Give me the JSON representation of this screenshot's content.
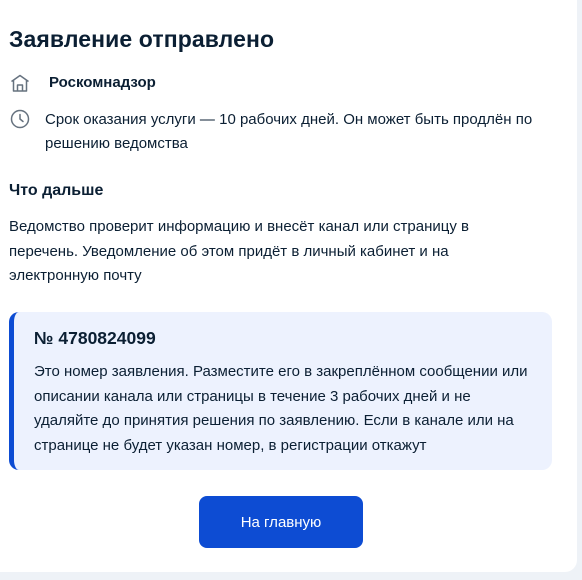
{
  "title": "Заявление отправлено",
  "organization": {
    "icon": "building-icon",
    "name": "Роскомнадзор"
  },
  "term": {
    "icon": "clock-icon",
    "text": "Срок оказания услуги — 10 рабочих дней. Он может быть продлён по решению ведомства"
  },
  "next": {
    "heading": "Что дальше",
    "text": "Ведомство проверит информацию и внесёт канал или страницу в перечень. Уведомление об этом придёт в личный кабинет и на электронную почту"
  },
  "notice": {
    "number": "№ 4780824099",
    "text": "Это номер заявления. Разместите его в закреплённом сообщении или описании канала или страницы в течение 3 рабочих дней и не удаляйте до принятия решения по заявлению. Если в канале или на странице не будет указан номер, в регистрации откажут"
  },
  "button": {
    "label": "На главную"
  },
  "colors": {
    "primary": "#0d4cd3",
    "notice_bg": "#edf2fe",
    "text": "#0b1f33",
    "icon": "#66727f"
  }
}
